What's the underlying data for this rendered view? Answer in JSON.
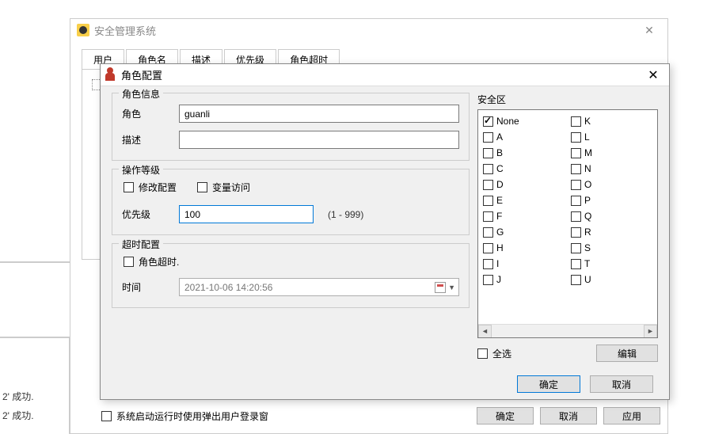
{
  "main": {
    "title": "安全管理系统"
  },
  "tabs": {
    "user": "用户",
    "t2": "角色名",
    "t3": "描述",
    "t4": "优先级",
    "t5": "角色超时"
  },
  "log": {
    "line1": "2' 成功.",
    "line2": "2' 成功."
  },
  "bottom": {
    "checkbox_label": "系统启动运行时使用弹出用户登录窗",
    "ok": "确定",
    "cancel": "取消",
    "apply": "应用"
  },
  "dialog": {
    "title": "角色配置",
    "group_role": "角色信息",
    "role_label": "角色",
    "role_value": "guanli",
    "desc_label": "描述",
    "desc_value": "",
    "group_op": "操作等级",
    "chk_modify": "修改配置",
    "chk_varaccess": "变量访问",
    "priority_label": "优先级",
    "priority_value": "100",
    "priority_hint": "(1 - 999)",
    "group_timeout": "超时配置",
    "chk_roletimeout": "角色超时.",
    "time_label": "时间",
    "time_value": "2021-10-06 14:20:56",
    "sec_label": "安全区",
    "selall": "全选",
    "edit": "编辑",
    "ok": "确定",
    "cancel": "取消",
    "zones_left": [
      {
        "label": "None",
        "checked": true
      },
      {
        "label": "A",
        "checked": false
      },
      {
        "label": "B",
        "checked": false
      },
      {
        "label": "C",
        "checked": false
      },
      {
        "label": "D",
        "checked": false
      },
      {
        "label": "E",
        "checked": false
      },
      {
        "label": "F",
        "checked": false
      },
      {
        "label": "G",
        "checked": false
      },
      {
        "label": "H",
        "checked": false
      },
      {
        "label": "I",
        "checked": false
      },
      {
        "label": "J",
        "checked": false
      }
    ],
    "zones_right": [
      {
        "label": "K",
        "checked": false
      },
      {
        "label": "L",
        "checked": false
      },
      {
        "label": "M",
        "checked": false
      },
      {
        "label": "N",
        "checked": false
      },
      {
        "label": "O",
        "checked": false
      },
      {
        "label": "P",
        "checked": false
      },
      {
        "label": "Q",
        "checked": false
      },
      {
        "label": "R",
        "checked": false
      },
      {
        "label": "S",
        "checked": false
      },
      {
        "label": "T",
        "checked": false
      },
      {
        "label": "U",
        "checked": false
      }
    ]
  }
}
